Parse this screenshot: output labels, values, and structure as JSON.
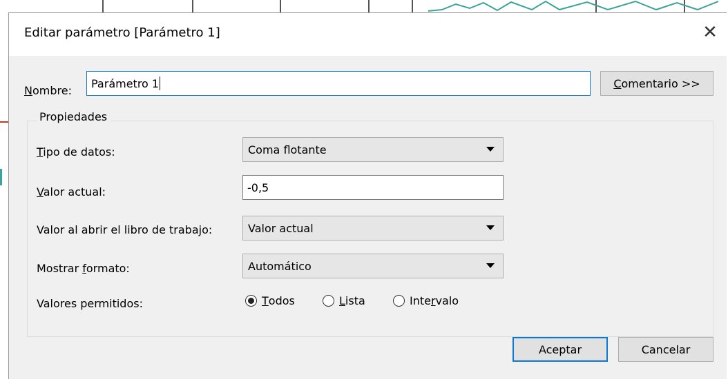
{
  "dialog": {
    "title": "Editar parámetro [Parámetro 1]",
    "close_icon": "close-icon"
  },
  "name": {
    "label_accel": "N",
    "label_rest": "ombre:",
    "value": "Parámetro 1"
  },
  "comment_button": {
    "accel": "C",
    "rest": "omentario >>"
  },
  "properties": {
    "group_label": "Propiedades",
    "data_type": {
      "label_accel": "T",
      "label_rest": "ipo de datos:",
      "value": "Coma flotante"
    },
    "current_value": {
      "label_accel": "V",
      "label_rest": "alor actual:",
      "value": "-0,5"
    },
    "on_open": {
      "label_pre": "Valor al abrir el libro de traba",
      "label_accel": "j",
      "label_post": "o:",
      "value": "Valor actual"
    },
    "display_format": {
      "label_pre": "Mostrar ",
      "label_accel": "f",
      "label_post": "ormato:",
      "value": "Automático"
    },
    "allowed_values": {
      "label": "Valores permitidos:",
      "options": [
        {
          "accel": "T",
          "rest": "odos",
          "selected": true
        },
        {
          "accel": "L",
          "rest": "ista",
          "selected": false
        },
        {
          "pre": "Inte",
          "accel": "r",
          "rest": "valo",
          "selected": false
        }
      ]
    }
  },
  "buttons": {
    "ok": "Aceptar",
    "cancel": "Cancelar"
  },
  "colors": {
    "focus": "#0a78d7",
    "dialog_bg": "#f0f0f0"
  }
}
